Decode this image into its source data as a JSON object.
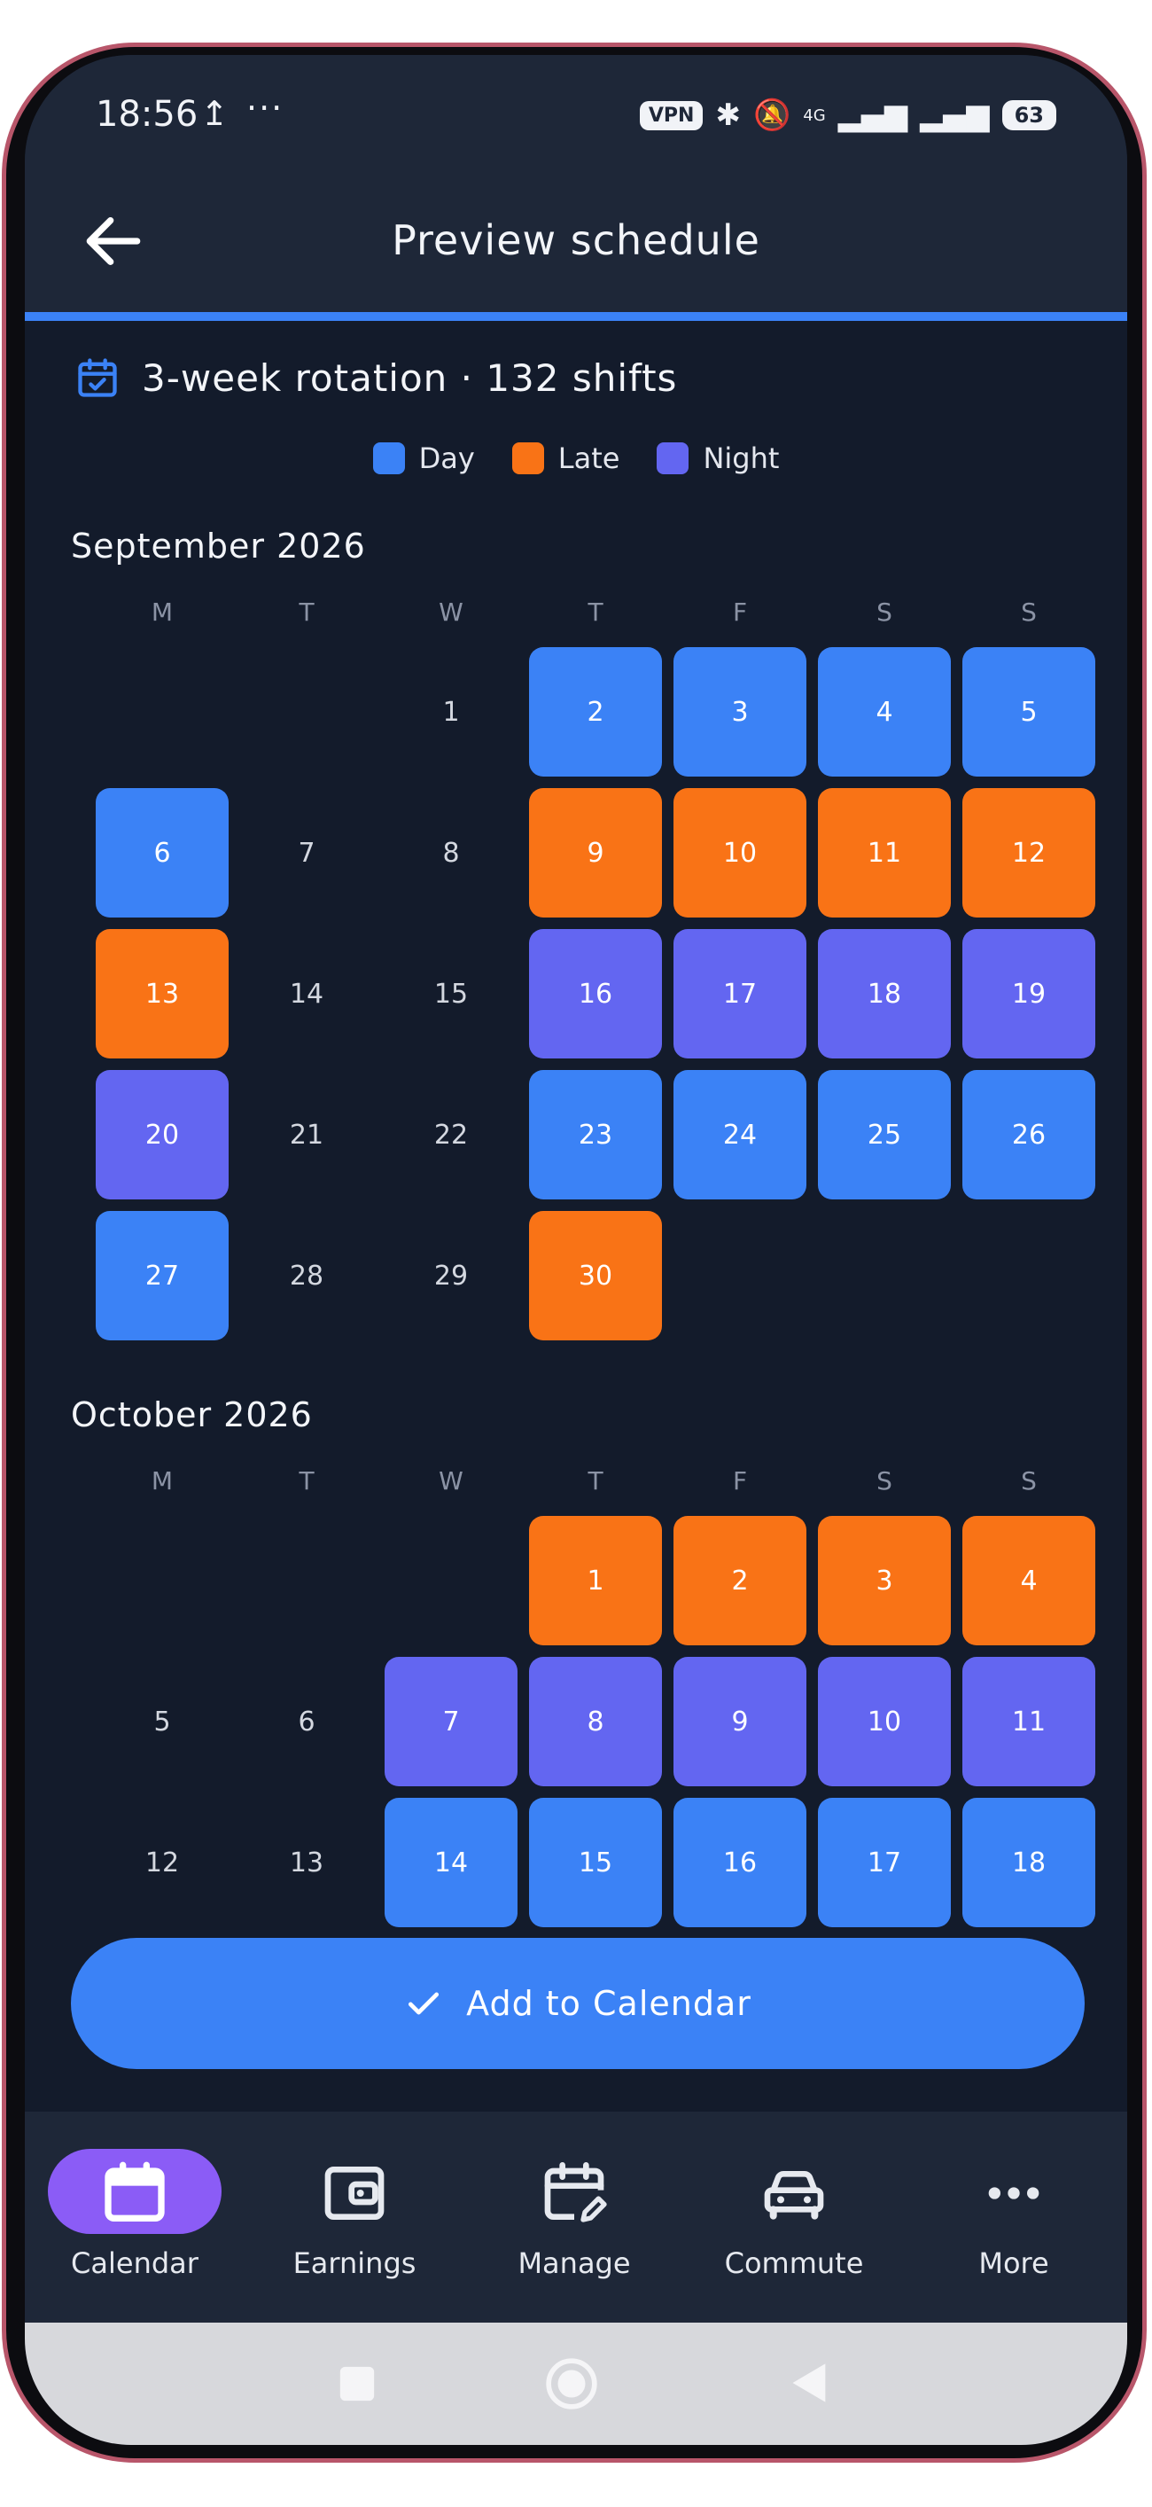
{
  "status_bar": {
    "time": "18:56",
    "upload_icon": "upload-icon",
    "more_icon": "dots-icon",
    "vpn": "VPN",
    "network": "4G",
    "battery": "63"
  },
  "app_bar": {
    "title": "Preview schedule",
    "back_icon": "arrow-left-icon"
  },
  "summary": {
    "text": "3-week rotation · 132 shifts",
    "icon": "calendar-check-icon"
  },
  "legend": [
    {
      "label": "Day",
      "color": "#3b82f6"
    },
    {
      "label": "Late",
      "color": "#f97316"
    },
    {
      "label": "Night",
      "color": "#6366f1"
    }
  ],
  "shift_colors": {
    "D": "#3b82f6",
    "L": "#f97316",
    "N": "#6366f1"
  },
  "weekdays": [
    "M",
    "T",
    "W",
    "T",
    "F",
    "S",
    "S"
  ],
  "months": [
    {
      "title": "September 2026",
      "first_weekday": 2,
      "days": 30,
      "shifts": {
        "2": "D",
        "3": "D",
        "4": "D",
        "5": "D",
        "6": "D",
        "9": "L",
        "10": "L",
        "11": "L",
        "12": "L",
        "13": "L",
        "16": "N",
        "17": "N",
        "18": "N",
        "19": "N",
        "20": "N",
        "23": "D",
        "24": "D",
        "25": "D",
        "26": "D",
        "27": "D",
        "30": "L"
      }
    },
    {
      "title": "October 2026",
      "first_weekday": 3,
      "days": 18,
      "shifts": {
        "1": "L",
        "2": "L",
        "3": "L",
        "4": "L",
        "7": "N",
        "8": "N",
        "9": "N",
        "10": "N",
        "11": "N",
        "14": "D",
        "15": "D",
        "16": "D",
        "17": "D",
        "18": "D"
      }
    }
  ],
  "add_button": {
    "label": "Add to Calendar",
    "icon": "check-icon"
  },
  "nav": [
    {
      "label": "Calendar",
      "icon": "calendar-icon",
      "active": true,
      "active_color": "#8b5cf6"
    },
    {
      "label": "Earnings",
      "icon": "wallet-icon",
      "active": false
    },
    {
      "label": "Manage",
      "icon": "calendar-edit-icon",
      "active": false
    },
    {
      "label": "Commute",
      "icon": "car-icon",
      "active": false
    },
    {
      "label": "More",
      "icon": "more-icon",
      "active": false
    }
  ]
}
